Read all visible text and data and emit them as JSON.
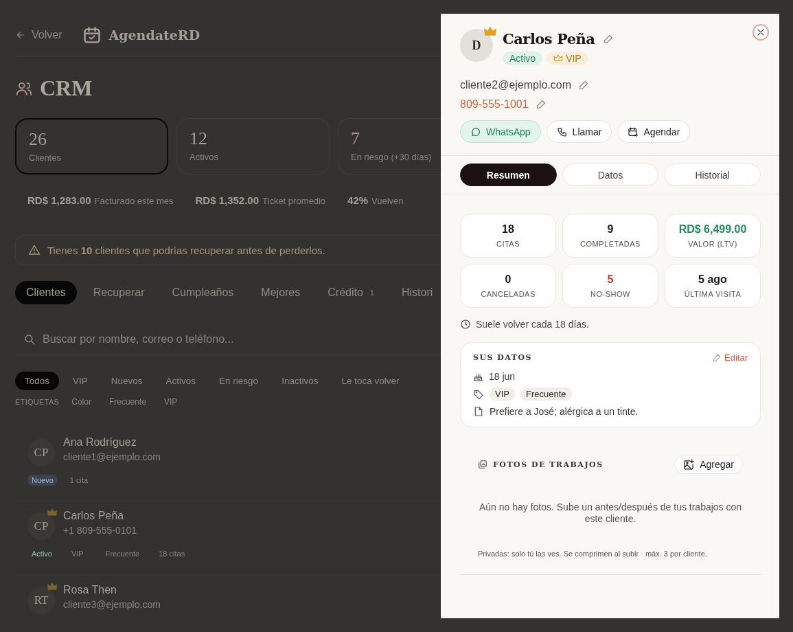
{
  "page": {
    "back_link": "Volver",
    "brand": "AgendateRD",
    "title": "CRM",
    "stats": [
      {
        "value": "26",
        "label": "Clientes",
        "selected": true,
        "kind": "plain"
      },
      {
        "value": "12",
        "label": "Activos",
        "selected": false,
        "kind": "plain"
      },
      {
        "value": "7",
        "label": "En riesgo (+30 días)",
        "selected": false,
        "kind": "risk"
      }
    ],
    "metrics": [
      {
        "value": "RD$ 1,283.00",
        "label": "Facturado este mes"
      },
      {
        "value": "RD$ 1,352.00",
        "label": "Ticket promedio"
      },
      {
        "value": "42%",
        "label": "Vuelven"
      }
    ],
    "alert": "Tienes **10** clientes que podrías recuperar antes de perderlos.",
    "tabs": [
      {
        "label": "Clientes",
        "selected": true
      },
      {
        "label": "Recuperar",
        "selected": false
      },
      {
        "label": "Cumpleaños",
        "selected": false
      },
      {
        "label": "Mejores",
        "selected": false
      },
      {
        "label": "Crédito",
        "badge": "1",
        "selected": false
      },
      {
        "label": "Histori",
        "selected": false
      }
    ],
    "search": {
      "placeholder": "Buscar por nombre, correo o teléfono..."
    },
    "filters": [
      {
        "label": "Todos",
        "selected": true
      },
      {
        "label": "VIP",
        "selected": false
      },
      {
        "label": "Nuevos",
        "selected": false
      },
      {
        "label": "Activos",
        "selected": false
      },
      {
        "label": "En riesgo",
        "selected": false
      },
      {
        "label": "Inactivos",
        "selected": false
      },
      {
        "label": "Le toca volver",
        "selected": false
      }
    ],
    "tags_label": "ETIQUETAS",
    "tag_filters": [
      "Color",
      "Frecuente",
      "VIP"
    ],
    "clients": [
      {
        "initials": "CP",
        "vip": false,
        "name": "Ana Rodríguez",
        "contact": "cliente1@ejemplo.com",
        "tags": [
          {
            "label": "Nuevo",
            "kind": "new"
          },
          {
            "label": "1 cita",
            "kind": "count"
          }
        ]
      },
      {
        "initials": "CP",
        "vip": true,
        "name": "Carlos Peña",
        "contact": "+1 809-555-0101",
        "tags": [
          {
            "label": "Activo",
            "kind": "active"
          },
          {
            "label": "VIP",
            "kind": "tag"
          },
          {
            "label": "Frecuente",
            "kind": "tag"
          },
          {
            "label": "18 citas",
            "kind": "count"
          }
        ]
      },
      {
        "initials": "RT",
        "vip": true,
        "name": "Rosa Then",
        "contact": "cliente3@ejemplo.com"
      }
    ]
  },
  "drawer": {
    "avatar": "D",
    "vip": true,
    "name": "Carlos Peña",
    "badges": [
      {
        "label": "Activo",
        "kind": "status"
      },
      {
        "label": "VIP",
        "kind": "vip"
      }
    ],
    "email": "cliente2@ejemplo.com",
    "phone": "809-555-1001",
    "actions": [
      {
        "label": "WhatsApp",
        "kind": "whatsapp"
      },
      {
        "label": "Llamar",
        "kind": "call"
      },
      {
        "label": "Agendar",
        "kind": "schedule"
      }
    ],
    "tabs": [
      {
        "label": "Resumen",
        "selected": true
      },
      {
        "label": "Datos",
        "selected": false
      },
      {
        "label": "Historial",
        "selected": false
      }
    ],
    "stats": [
      {
        "value": "18",
        "label": "CITAS",
        "kind": "plain"
      },
      {
        "value": "9",
        "label": "COMPLETADAS",
        "kind": "plain"
      },
      {
        "value": "RD$ 6,499.00",
        "label": "VALOR (LTV)",
        "kind": "positive"
      },
      {
        "value": "0",
        "label": "CANCELADAS",
        "kind": "plain"
      },
      {
        "value": "5",
        "label": "NO-SHOW",
        "kind": "negative"
      },
      {
        "value": "5 ago",
        "label": "ÚLTIMA VISITA",
        "kind": "plain"
      }
    ],
    "return_note": "Suele volver cada 18 días.",
    "details": {
      "title": "SUS DATOS",
      "edit": "Editar",
      "birthday": "18 jun",
      "tags": [
        "VIP",
        "Frecuente"
      ],
      "note": "Prefiere a José; alérgica a un tinte."
    },
    "photos": {
      "title": "FOTOS DE TRABAJOS",
      "add": "Agregar",
      "empty": "Aún no hay fotos. Sube un antes/después de tus trabajos con este cliente.",
      "privacy": "Privadas: solo tú las ves. Se comprimen al subir · máx. 3 por cliente."
    }
  }
}
